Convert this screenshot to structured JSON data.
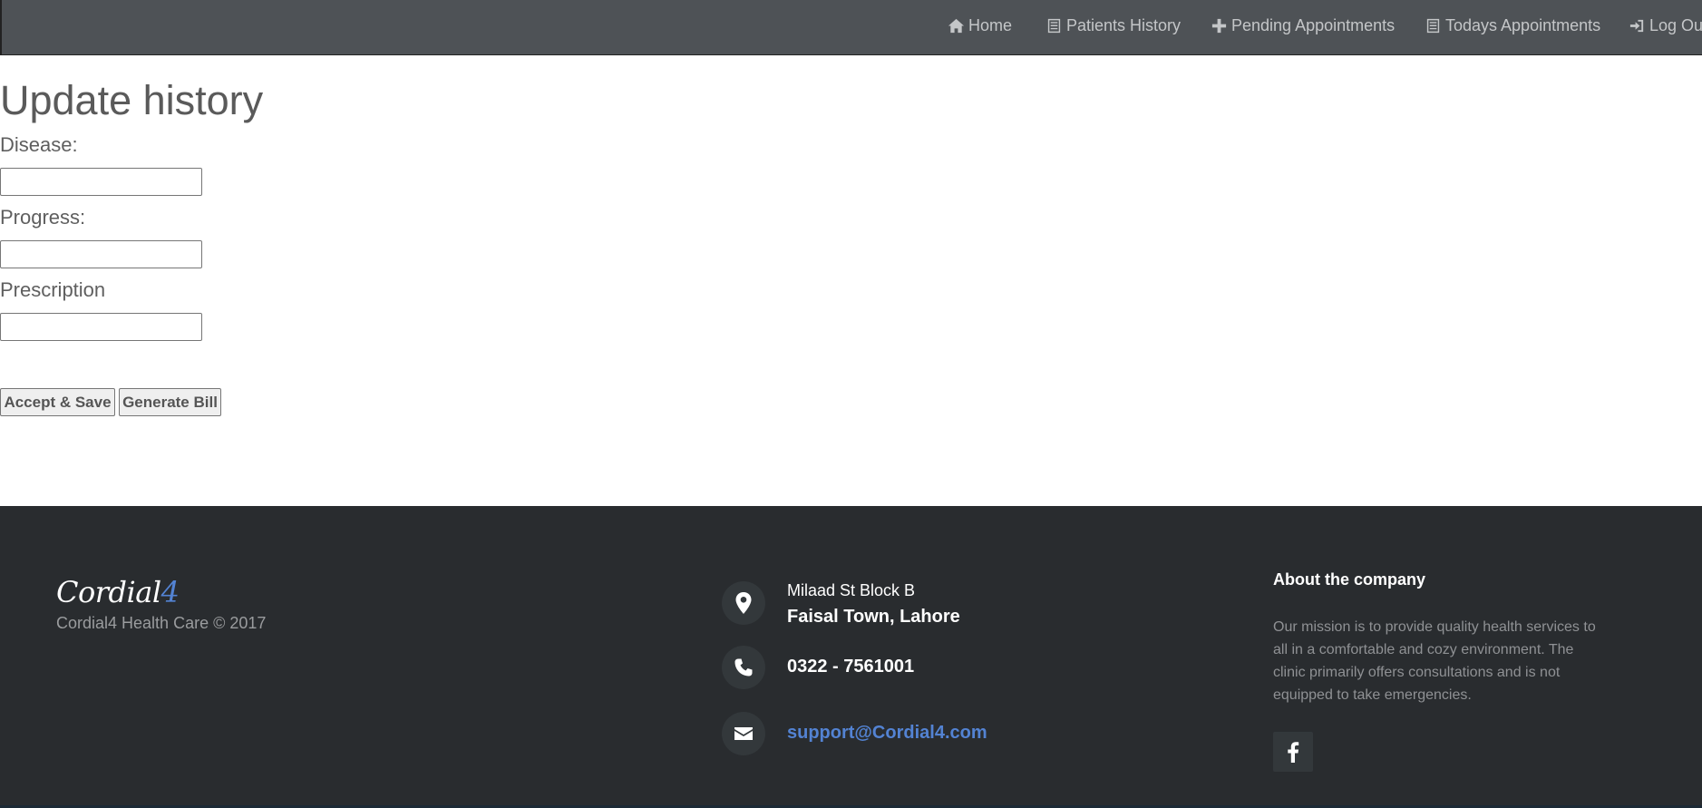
{
  "navbar": {
    "items": [
      {
        "label": "Home",
        "icon": "home-icon"
      },
      {
        "label": "Patients History",
        "icon": "list-icon"
      },
      {
        "label": "Pending Appointments",
        "icon": "plus-icon"
      },
      {
        "label": "Todays Appointments",
        "icon": "list-icon"
      },
      {
        "label": "Log Out",
        "icon": "log-in-icon"
      }
    ]
  },
  "main": {
    "title": "Update history",
    "fields": [
      {
        "label": "Disease:",
        "value": ""
      },
      {
        "label": "Progress:",
        "value": ""
      },
      {
        "label": "Prescription",
        "value": ""
      }
    ],
    "buttons": {
      "accept": "Accept & Save",
      "bill": "Generate Bill"
    }
  },
  "footer": {
    "logo_main": "Cordial",
    "logo_accent": "4",
    "copyright": "Cordial4 Health Care © 2017",
    "address_line1": "Milaad St Block B",
    "address_line2": "Faisal Town, Lahore",
    "phone": "0322 - 7561001",
    "email": "support@Cordial4.com",
    "about_title": "About the company",
    "about_text": "Our mission is to provide quality health services to all in a comfortable and cozy environment. The clinic primarily offers consultations and is not equipped to take emergencies."
  },
  "colors": {
    "navbar_bg": "#4e5256",
    "footer_bg": "#292c2f",
    "accent": "#5383d3"
  }
}
